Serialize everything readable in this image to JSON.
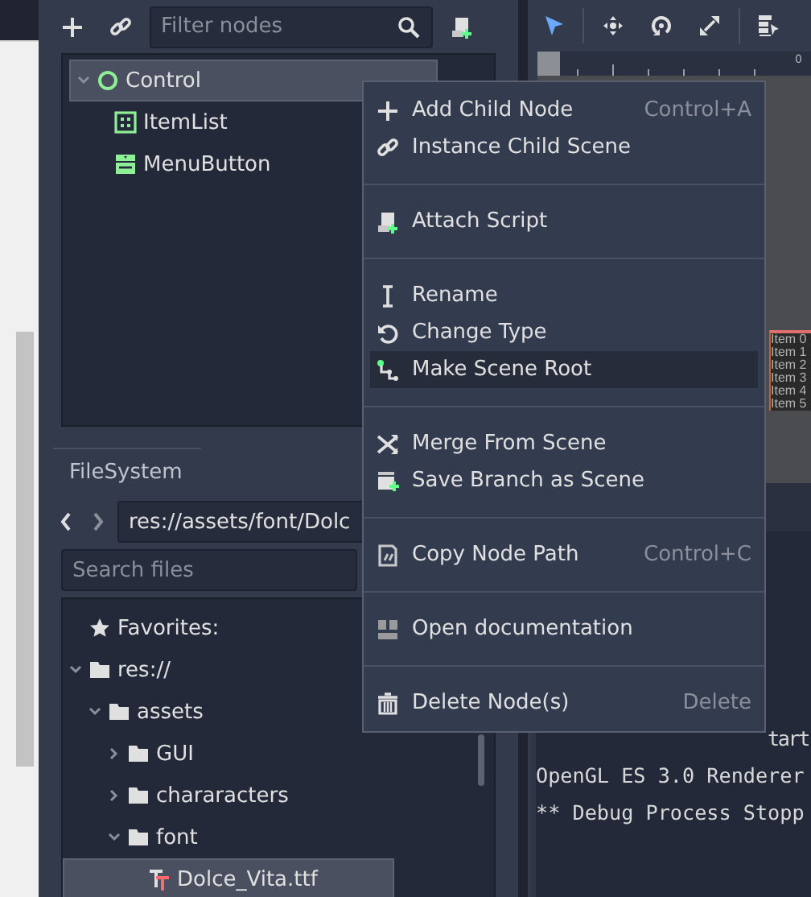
{
  "scene_dock": {
    "filter": {
      "placeholder": "Filter nodes"
    },
    "tree": [
      {
        "label": "Control",
        "kind": "control",
        "selected": true,
        "expanded": true,
        "children": [
          {
            "label": "ItemList",
            "kind": "itemlist",
            "selected": false
          },
          {
            "label": "MenuButton",
            "kind": "menubutton",
            "selected": false
          }
        ]
      }
    ]
  },
  "filesystem_dock": {
    "tabs": [
      {
        "label": "FileSystem",
        "selected": true
      }
    ],
    "path": "res://assets/font/Dolc",
    "search": {
      "placeholder": "Search files"
    },
    "tree": [
      {
        "label": "Favorites:",
        "kind": "favorites",
        "selected": false
      },
      {
        "label": "res://",
        "kind": "folder",
        "selected": false,
        "expanded": true,
        "children": [
          {
            "label": "assets",
            "kind": "folder",
            "selected": false,
            "expanded": true,
            "children": [
              {
                "label": "GUI",
                "kind": "folder",
                "selected": false,
                "expanded": false
              },
              {
                "label": "chararacters",
                "kind": "folder",
                "selected": false,
                "expanded": false
              },
              {
                "label": "font",
                "kind": "folder",
                "selected": false,
                "expanded": true,
                "children": [
                  {
                    "label": "Dolce_Vita.ttf",
                    "kind": "font",
                    "selected": true
                  }
                ]
              }
            ]
          }
        ]
      }
    ]
  },
  "viewport": {
    "tools": [
      {
        "kind": "select",
        "selected": true
      },
      {
        "kind": "move",
        "selected": false
      },
      {
        "kind": "rotate",
        "selected": false
      },
      {
        "kind": "scale",
        "selected": false
      },
      {
        "kind": "list",
        "selected": false
      }
    ],
    "ruler_label": "0",
    "item_list": [
      "Item 0",
      "Item 1",
      "Item 2",
      "Item 3",
      "Item 4",
      "Item 5"
    ]
  },
  "output": {
    "lines": [
      "tart",
      "OpenGL ES 3.0 Renderer",
      "** Debug Process Stopp"
    ]
  },
  "context_menu": {
    "items": [
      {
        "kind": "item",
        "label": "Add Child Node",
        "shortcut": "Control+A",
        "selected": false
      },
      {
        "kind": "item",
        "label": "Instance Child Scene",
        "selected": false
      },
      {
        "kind": "separator"
      },
      {
        "kind": "item",
        "label": "Attach Script",
        "selected": false
      },
      {
        "kind": "separator"
      },
      {
        "kind": "item",
        "label": "Rename",
        "selected": false
      },
      {
        "kind": "item",
        "label": "Change Type",
        "selected": false
      },
      {
        "kind": "item",
        "label": "Make Scene Root",
        "selected": true
      },
      {
        "kind": "separator"
      },
      {
        "kind": "item",
        "label": "Merge From Scene",
        "selected": false
      },
      {
        "kind": "item",
        "label": "Save Branch as Scene",
        "selected": false
      },
      {
        "kind": "separator"
      },
      {
        "kind": "item",
        "label": "Copy Node Path",
        "shortcut": "Control+C",
        "selected": false
      },
      {
        "kind": "separator"
      },
      {
        "kind": "item",
        "label": "Open documentation",
        "selected": false
      },
      {
        "kind": "separator"
      },
      {
        "kind": "item",
        "label": "Delete Node(s)",
        "shortcut": "Delete",
        "selected": false
      }
    ]
  }
}
